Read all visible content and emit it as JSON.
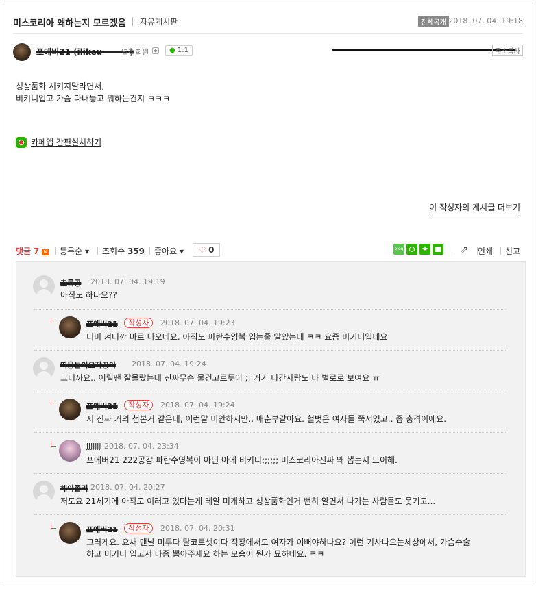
{
  "post": {
    "title": "미스코리아 왜하는지 모르겠음",
    "board": "자유게시판",
    "scope": "전체공개",
    "date": "2018. 07. 04.  19:18",
    "author": "포에버21 (ilikeu~~~~)",
    "grade": "열정회원",
    "chat": "1:1",
    "copy_button": "주소복사",
    "body_lines": [
      "성상품화 시키지말라면서,",
      "비키니입고 가슴 다내놓고 뭐하는건지 ㅋㅋㅋ"
    ],
    "app_install": "카페앱 간편설치하기",
    "more_posts": "이 작성자의 게시글 더보기"
  },
  "bar": {
    "comments_label": "댓글",
    "comments_count": "7",
    "new_badge": "N",
    "sort": "등록순",
    "views_label": "조회수",
    "views": "359",
    "likes_label": "좋아요",
    "like_count": "0",
    "print": "인쇄",
    "report": "신고"
  },
  "comments": [
    {
      "name": "초록공",
      "date": "2018. 07. 04.  19:19",
      "text": "아직도 하나요??",
      "reply": false,
      "writer": false
    },
    {
      "name": "포에버21",
      "date": "2018. 07. 04.  19:23",
      "text": "티비 켜니깐 바로 나오네요. 아직도 파란수영복 입는줄 알았는데 ㅋㅋ 요즘 비키니입네요",
      "reply": true,
      "writer": true
    },
    {
      "name": "띠용돌이오작꿍이",
      "date": "2018. 07. 04.  19:24",
      "text": " 그니까요.. 어릴땐 잘몰랐는데 진짜무슨 물건고르듯이 ;; 거기 나간사람도 다 별로로 보여요 ㅠ",
      "reply": false,
      "writer": false
    },
    {
      "name": "포에버21",
      "date": "2018. 07. 04.  19:24",
      "text": "저 진짜 거의 첨본거 같은데, 이런말 미안하지만.. 매춘부같아요. 헐벗은 여자들 쭉서있고.. 좀 충격이에요.",
      "reply": true,
      "writer": true
    },
    {
      "name": "jjjjjjj",
      "date": "2018. 07. 04.  23:34",
      "text": "포에버21  222공감 파란수영복이 아닌 아에 비키니;;;;;; 미스코리아진짜 왜 뽑는지 노이해.",
      "reply": true,
      "writer": false
    },
    {
      "name": "해아졸리",
      "date": "2018. 07. 04.  20:27",
      "text": "저도요 21세기에 아직도 이러고 있다는게 레알 미개하고 성상품화인거 뻔히 알면서 나가는 사람들도 웃기고...",
      "reply": false,
      "writer": false
    },
    {
      "name": "포에버21",
      "date": "2018. 07. 04.  20:31",
      "text_lines": [
        "그러게요. 요새 맨날 미투다 탈코르셋이다 직장에서도 여자가 이뻐야하나요? 이런 기사나오는세상에서, 가슴수술",
        "하고 비키니 입고서 나좀 뽑아주세요 하는 모습이 뭔가 묘하네요. ㅋㅋ"
      ],
      "reply": true,
      "writer": true
    }
  ],
  "writer_badge": "작성자"
}
